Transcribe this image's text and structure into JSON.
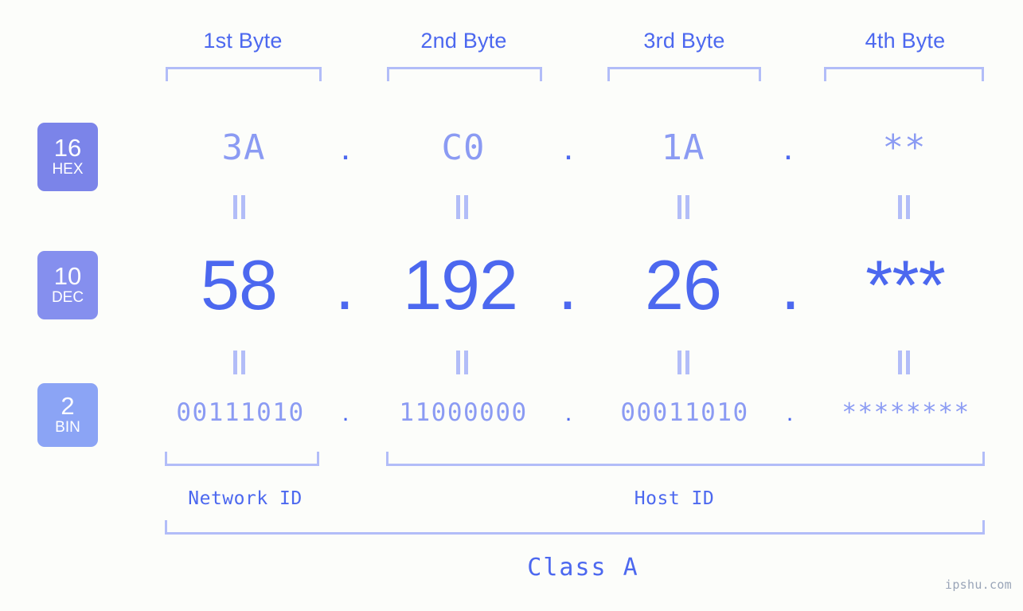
{
  "colors": {
    "background": "#fcfdfa",
    "accent_strong": "#4c68ef",
    "accent_light": "#8b9bf3",
    "bracket": "#b2bdf8",
    "badge_hex": "#7b84e9",
    "badge_dec": "#858fee",
    "badge_bin": "#8ba4f5",
    "watermark": "#9aa5b8"
  },
  "byte_headers": [
    {
      "label": "1st Byte"
    },
    {
      "label": "2nd Byte"
    },
    {
      "label": "3rd Byte"
    },
    {
      "label": "4th Byte"
    }
  ],
  "separator": ".",
  "rows": [
    {
      "id": "hex",
      "badge": {
        "radix": "16",
        "name": "HEX"
      },
      "values": [
        "3A",
        "C0",
        "1A",
        "**"
      ]
    },
    {
      "id": "dec",
      "badge": {
        "radix": "10",
        "name": "DEC"
      },
      "values": [
        "58",
        "192",
        "26",
        "***"
      ]
    },
    {
      "id": "bin",
      "badge": {
        "radix": "2",
        "name": "BIN"
      },
      "values": [
        "00111010",
        "11000000",
        "00011010",
        "********"
      ]
    }
  ],
  "segments": {
    "network_id": "Network ID",
    "host_id": "Host ID",
    "class": "Class A"
  },
  "watermark": "ipshu.com"
}
